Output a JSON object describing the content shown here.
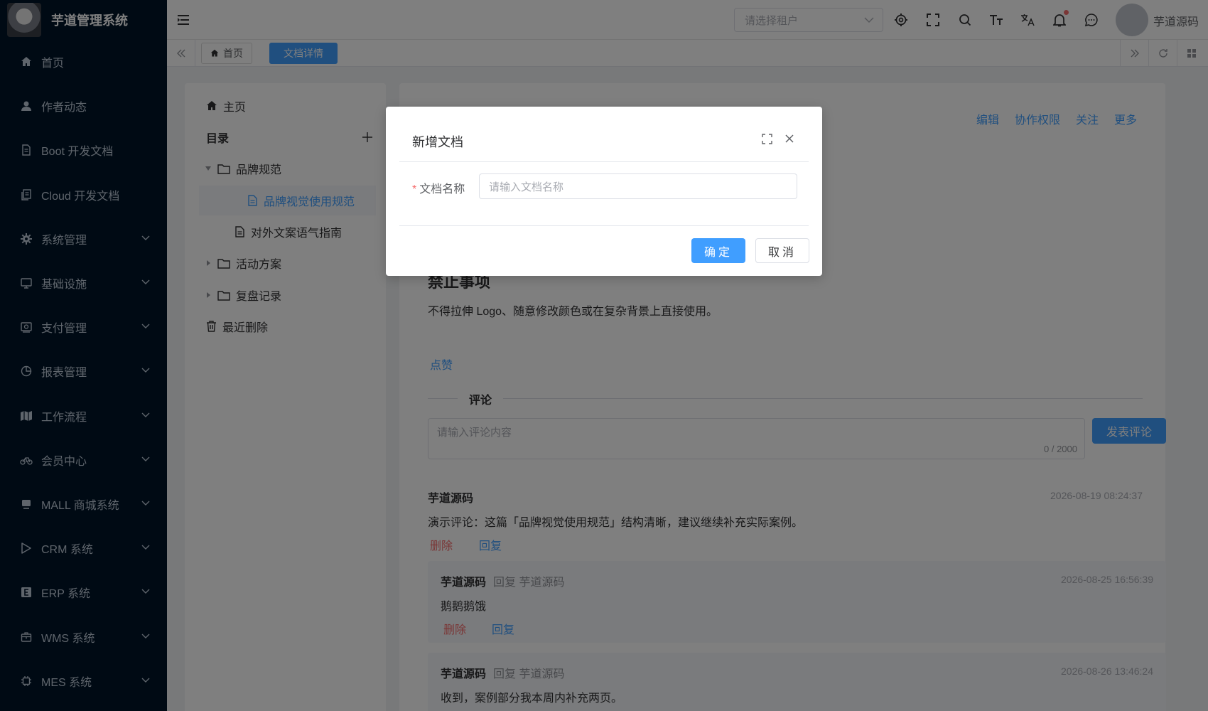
{
  "app": {
    "title": "芋道管理系统"
  },
  "sidebar": {
    "items": [
      {
        "label": "首页",
        "icon": "home-icon"
      },
      {
        "label": "作者动态",
        "icon": "user-icon"
      },
      {
        "label": "Boot 开发文档",
        "icon": "document-icon"
      },
      {
        "label": "Cloud 开发文档",
        "icon": "documents-icon"
      },
      {
        "label": "系统管理",
        "icon": "gear-icon"
      },
      {
        "label": "基础设施",
        "icon": "monitor-icon"
      },
      {
        "label": "支付管理",
        "icon": "payment-icon"
      },
      {
        "label": "报表管理",
        "icon": "pie-chart-icon"
      },
      {
        "label": "工作流程",
        "icon": "map-icon"
      },
      {
        "label": "会员中心",
        "icon": "bicycle-icon"
      },
      {
        "label": "MALL 商城系统",
        "icon": "shop-icon"
      },
      {
        "label": "CRM 系统",
        "icon": "crm-icon"
      },
      {
        "label": "ERP 系统",
        "icon": "erp-icon"
      },
      {
        "label": "WMS 系统",
        "icon": "box-icon"
      },
      {
        "label": "MES 系统",
        "icon": "chip-icon"
      }
    ]
  },
  "header": {
    "tenant_placeholder": "请选择租户",
    "username": "芋道源码"
  },
  "tags": {
    "home": "首页",
    "active": "文档详情"
  },
  "tree": {
    "home": "主页",
    "catalog": "目录",
    "brand": "品牌规范",
    "brand_visual": "品牌视觉使用规范",
    "brand_copy": "对外文案语气指南",
    "activity": "活动方案",
    "review": "复盘记录",
    "recent_deleted": "最近删除"
  },
  "doc": {
    "actions": [
      "编辑",
      "协作权限",
      "关注",
      "更多"
    ],
    "section_title": "禁止事项",
    "section_text": "不得拉伸 Logo、随意修改颜色或在复杂背景上直接使用。",
    "like": "点赞",
    "comments_title": "评论",
    "comment_placeholder": "请输入评论内容",
    "comment_count": "0 / 2000",
    "comment_submit": "发表评论"
  },
  "comments": [
    {
      "author": "芋道源码",
      "time": "2026-08-19 08:24:37",
      "body": "演示评论：这篇「品牌视觉使用规范」结构清晰，建议继续补充实际案例。",
      "delete": "删除",
      "reply": "回复"
    },
    {
      "author": "芋道源码",
      "reply_to": "回复 芋道源码",
      "time": "2026-08-25 16:56:39",
      "body": "鹅鹅鹅饿",
      "delete": "删除",
      "reply": "回复"
    },
    {
      "author": "芋道源码",
      "reply_to": "回复 芋道源码",
      "time": "2026-08-26 13:46:24",
      "body": "收到，案例部分我本周内补充两页。"
    }
  ],
  "dialog": {
    "title": "新增文档",
    "field_label": "文档名称",
    "field_placeholder": "请输入文档名称",
    "ok": "确定",
    "cancel": "取消"
  },
  "colors": {
    "primary": "#409eff",
    "sidebar": "#001529",
    "danger": "#f56c6c"
  }
}
